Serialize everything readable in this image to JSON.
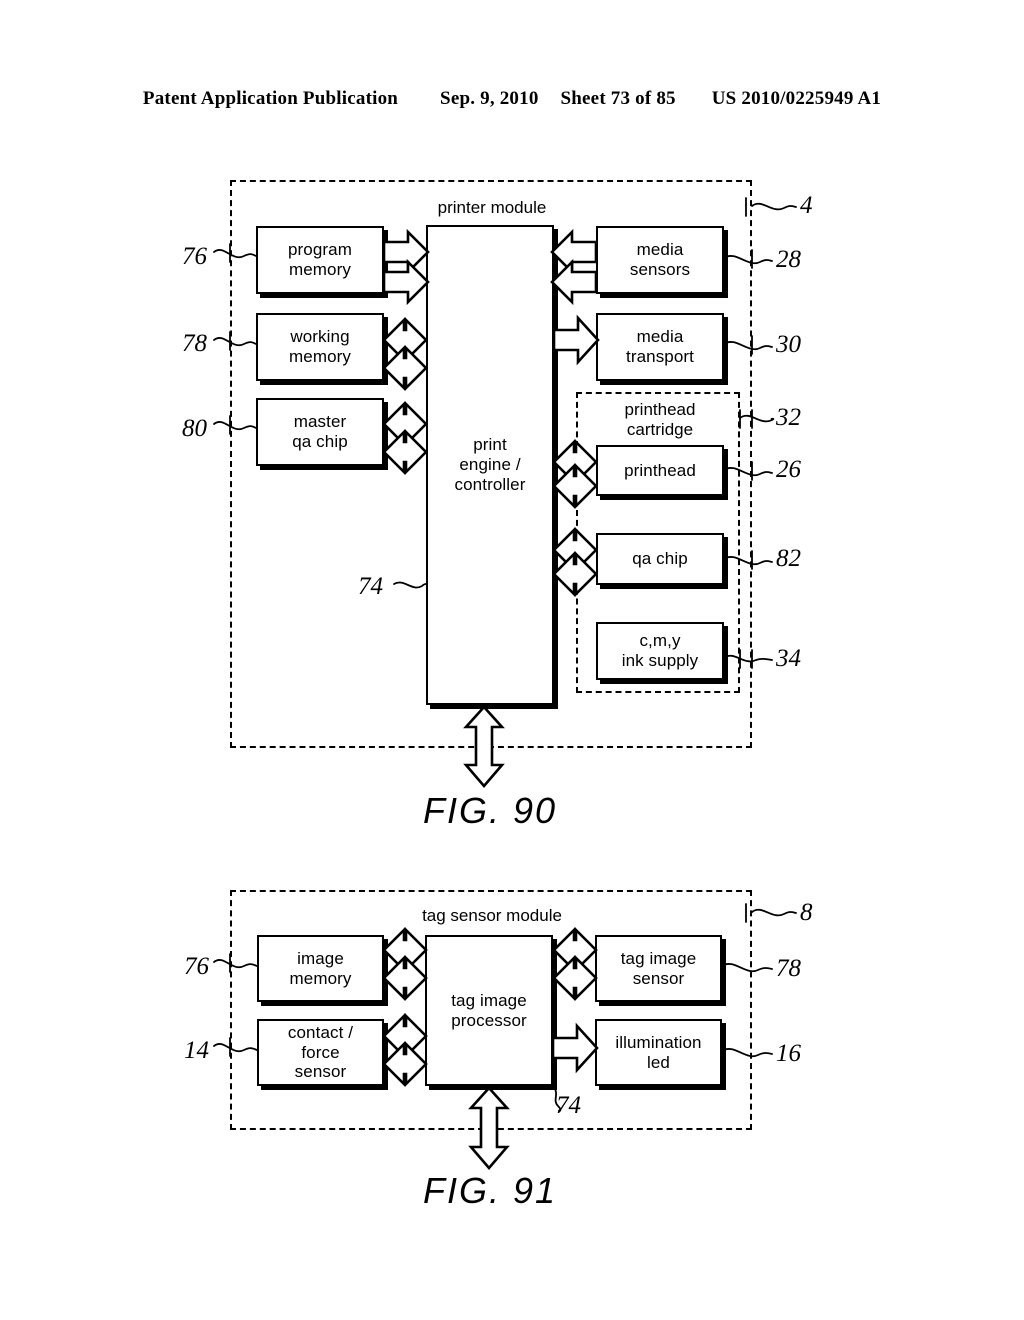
{
  "header": {
    "publication": "Patent Application Publication",
    "date": "Sep. 9, 2010",
    "sheet": "Sheet 73 of 85",
    "doc_number": "US 2010/0225949 A1"
  },
  "figures": [
    {
      "caption": "FIG. 90",
      "module_title": "printer module",
      "module_ref": "4",
      "center_block": {
        "label": "print\nengine /\ncontroller",
        "ref": "74"
      },
      "left_blocks": [
        {
          "label": "program\nmemory",
          "ref": "76",
          "link": "two-arrows-right"
        },
        {
          "label": "working\nmemory",
          "ref": "78",
          "link": "bidirectional"
        },
        {
          "label": "master\nqa chip",
          "ref": "80",
          "link": "bidirectional"
        }
      ],
      "right_blocks": [
        {
          "label": "media\nsensors",
          "ref": "28",
          "link": "two-arrows-left"
        },
        {
          "label": "media\ntransport",
          "ref": "30",
          "link": "arrow-right"
        }
      ],
      "sub_module": {
        "title": "printhead\ncartridge",
        "ref": "32",
        "blocks": [
          {
            "label": "printhead",
            "ref": "26",
            "link": "two-arrows-right"
          },
          {
            "label": "qa chip",
            "ref": "82",
            "link": "bidirectional"
          },
          {
            "label": "c,m,y\nink supply",
            "ref": "34",
            "link": "none"
          }
        ]
      },
      "bottom_arrow": "bidirectional-vertical"
    },
    {
      "caption": "FIG. 91",
      "module_title": "tag sensor module",
      "module_ref": "8",
      "center_block": {
        "label": "tag image\nprocessor",
        "ref": "74"
      },
      "left_blocks": [
        {
          "label": "image\nmemory",
          "ref": "76",
          "link": "bidirectional"
        },
        {
          "label": "contact /\nforce\nsensor",
          "ref": "14",
          "link": "bidirectional"
        }
      ],
      "right_blocks": [
        {
          "label": "tag image\nsensor",
          "ref": "78",
          "link": "bidirectional"
        },
        {
          "label": "illumination\nled",
          "ref": "16",
          "link": "arrow-right"
        }
      ],
      "bottom_arrow": "bidirectional-vertical"
    }
  ]
}
